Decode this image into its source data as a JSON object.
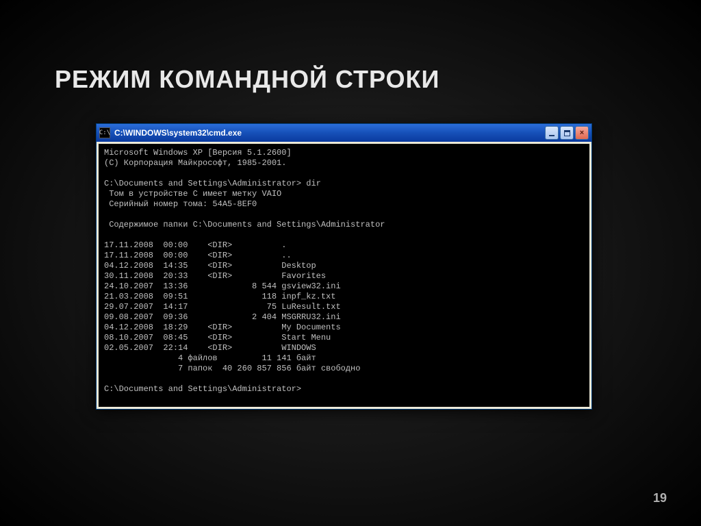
{
  "slide": {
    "title": "РЕЖИМ КОМАНДНОЙ СТРОКИ",
    "page_number": "19"
  },
  "window": {
    "icon_glyph": "C:\\",
    "title": "C:\\WINDOWS\\system32\\cmd.exe",
    "min_tooltip": "Minimize",
    "max_tooltip": "Maximize",
    "close_tooltip": "Close"
  },
  "terminal": {
    "header1": "Microsoft Windows XP [Версия 5.1.2600]",
    "header2": "(С) Корпорация Майкрософт, 1985-2001.",
    "prompt1": "C:\\Documents and Settings\\Administrator> dir",
    "vol_label": " Том в устройстве C имеет метку VAIO",
    "vol_serial": " Серийный номер тома: 54A5-8EF0",
    "dir_of": " Содержимое папки C:\\Documents and Settings\\Administrator",
    "rows": [
      "17.11.2008  00:00    <DIR>          .",
      "17.11.2008  00:00    <DIR>          ..",
      "04.12.2008  14:35    <DIR>          Desktop",
      "30.11.2008  20:33    <DIR>          Favorites",
      "24.10.2007  13:36             8 544 gsview32.ini",
      "21.03.2008  09:51               118 inpf_kz.txt",
      "29.07.2007  14:17                75 LuResult.txt",
      "09.08.2007  09:36             2 404 MSGRRU32.ini",
      "04.12.2008  18:29    <DIR>          My Documents",
      "08.10.2007  08:45    <DIR>          Start Menu",
      "02.05.2007  22:14    <DIR>          WINDOWS"
    ],
    "summary_files": "               4 файлов         11 141 байт",
    "summary_dirs": "               7 папок  40 260 857 856 байт свободно",
    "prompt2": "C:\\Documents and Settings\\Administrator>"
  }
}
